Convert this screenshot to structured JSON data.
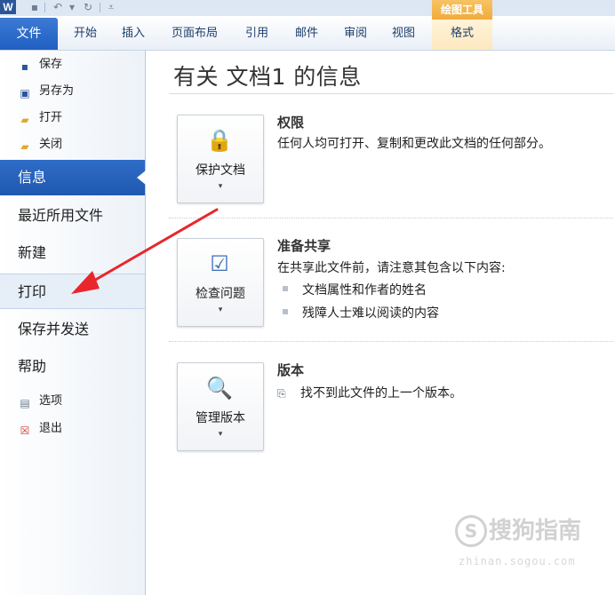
{
  "app": {
    "logo_letter": "W",
    "qat_icons": [
      "save-icon",
      "undo-icon",
      "redo-icon",
      "customize-icon"
    ]
  },
  "ribbon": {
    "file_tab": "文件",
    "tabs": [
      "开始",
      "插入",
      "页面布局",
      "引用",
      "邮件",
      "审阅",
      "视图"
    ],
    "context_group": "绘图工具",
    "context_tab": "格式"
  },
  "sidebar": {
    "commands_top": [
      {
        "label": "保存",
        "icon": "save-icon"
      },
      {
        "label": "另存为",
        "icon": "save-as-icon"
      },
      {
        "label": "打开",
        "icon": "open-folder-icon"
      },
      {
        "label": "关闭",
        "icon": "close-folder-icon"
      }
    ],
    "nav": [
      "信息",
      "最近所用文件",
      "新建",
      "打印",
      "保存并发送",
      "帮助"
    ],
    "selected": "信息",
    "hovered": "打印",
    "commands_bottom": [
      {
        "label": "选项",
        "icon": "options-icon"
      },
      {
        "label": "退出",
        "icon": "exit-icon"
      }
    ]
  },
  "main": {
    "title": "有关 文档1 的信息",
    "sections": [
      {
        "button_label": "保护文档",
        "button_icon": "lock-key-icon",
        "heading": "权限",
        "text": "任何人均可打开、复制和更改此文档的任何部分。"
      },
      {
        "button_label": "检查问题",
        "button_icon": "checklist-icon",
        "heading": "准备共享",
        "text": "在共享此文件前，请注意其包含以下内容:",
        "bullets": [
          "文档属性和作者的姓名",
          "残障人士难以阅读的内容"
        ]
      },
      {
        "button_label": "管理版本",
        "button_icon": "versions-magnifier-icon",
        "heading": "版本",
        "text": "找不到此文件的上一个版本。"
      }
    ]
  },
  "watermark": {
    "mark": "S",
    "text": "搜狗指南",
    "sub": "zhinan.sogou.com"
  },
  "colors": {
    "accent": "#2f6dc8",
    "arrow": "#e8262b",
    "context": "#f1ab3a"
  }
}
